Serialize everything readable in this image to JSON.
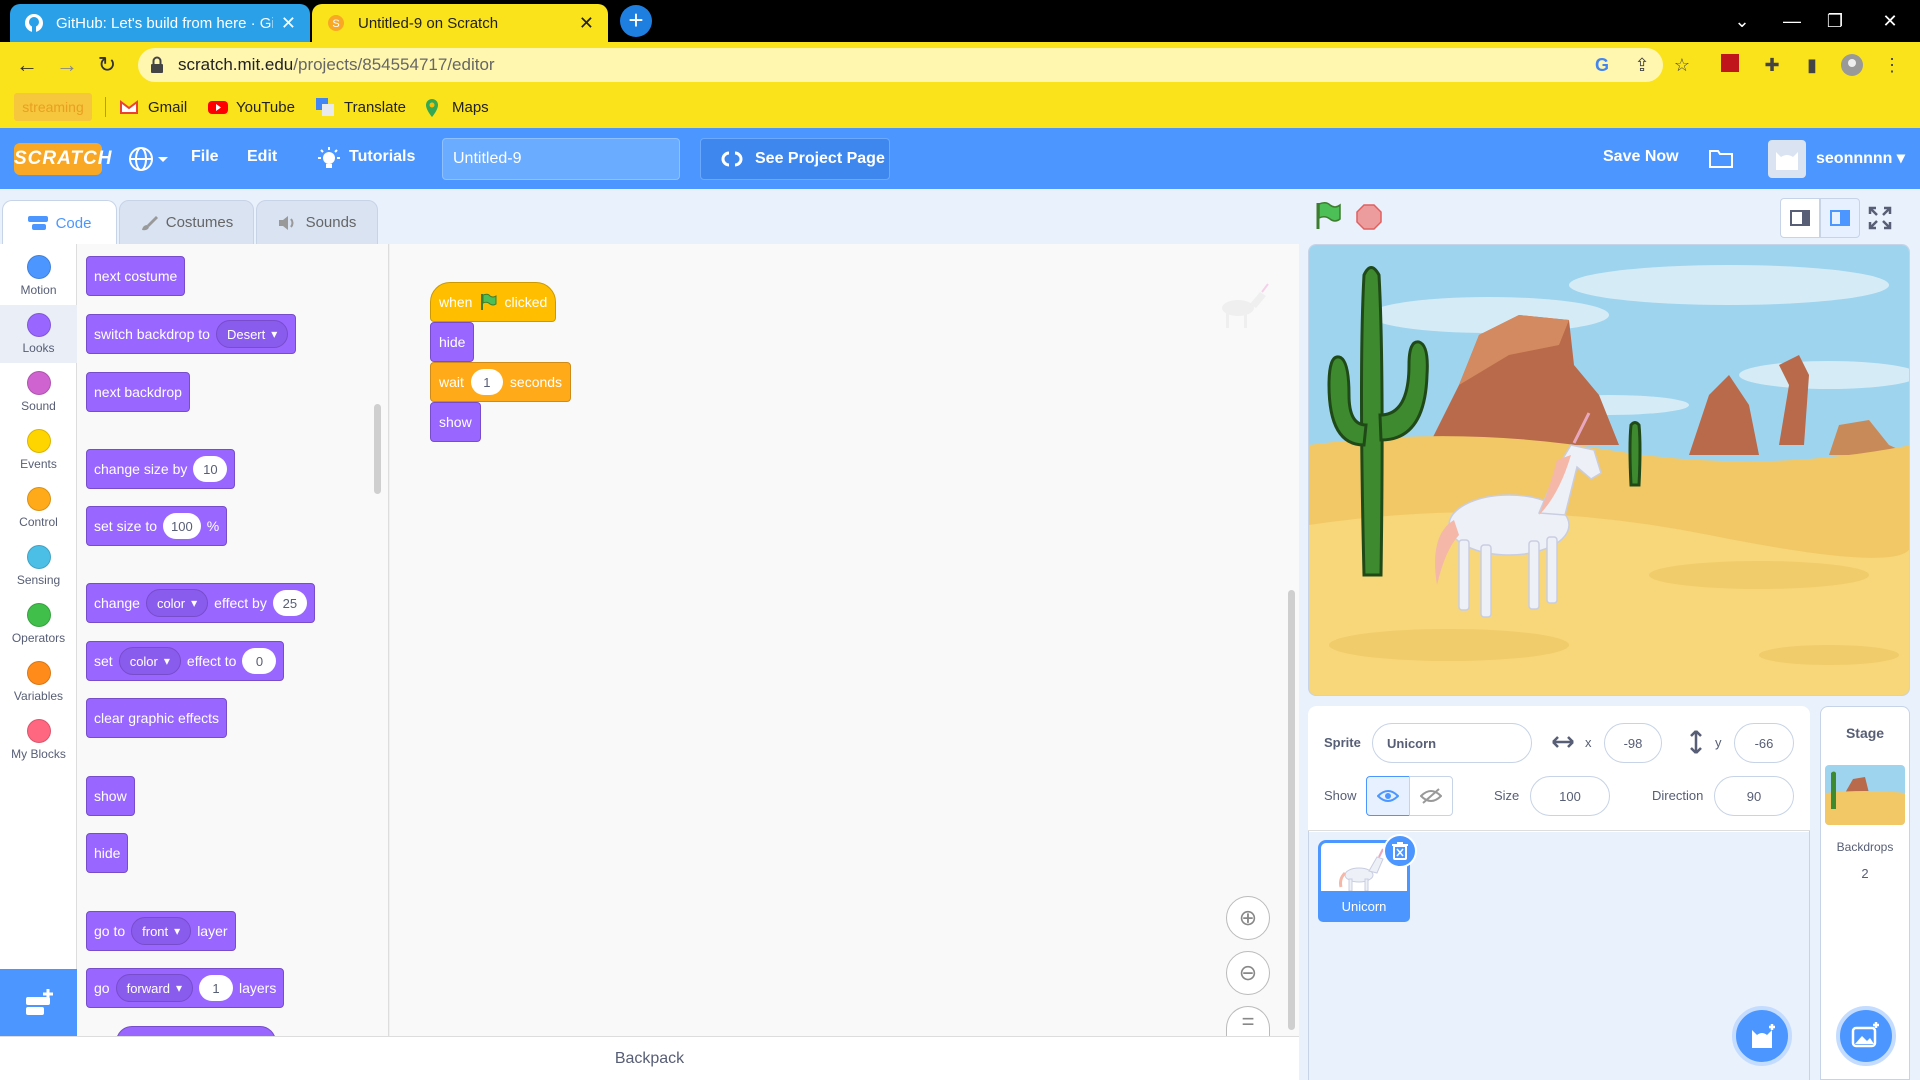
{
  "browser": {
    "tabs": [
      {
        "title": "GitHub: Let's build from here · Gi",
        "active": false
      },
      {
        "title": "Untitled-9 on Scratch",
        "active": true
      }
    ],
    "url_host": "scratch.mit.edu",
    "url_path": "/projects/854554717/editor",
    "bookmarks": [
      "streaming",
      "Gmail",
      "YouTube",
      "Translate",
      "Maps"
    ]
  },
  "menubar": {
    "logo": "SCRATCH",
    "file": "File",
    "edit": "Edit",
    "tutorials": "Tutorials",
    "project_title": "Untitled-9",
    "see_project": "See Project Page",
    "save_now": "Save Now",
    "username": "seonnnnn"
  },
  "editor_tabs": [
    "Code",
    "Costumes",
    "Sounds"
  ],
  "categories": [
    {
      "label": "Motion",
      "color": "#4c97ff"
    },
    {
      "label": "Looks",
      "color": "#9966ff"
    },
    {
      "label": "Sound",
      "color": "#cf63cf"
    },
    {
      "label": "Events",
      "color": "#ffd500"
    },
    {
      "label": "Control",
      "color": "#ffab19"
    },
    {
      "label": "Sensing",
      "color": "#4cbfe6"
    },
    {
      "label": "Operators",
      "color": "#40bf4a"
    },
    {
      "label": "Variables",
      "color": "#ff8c1a"
    },
    {
      "label": "My Blocks",
      "color": "#ff6680"
    }
  ],
  "palette": {
    "next_costume": "next costume",
    "switch_backdrop": "switch backdrop to",
    "backdrop_value": "Desert",
    "next_backdrop": "next backdrop",
    "change_size": "change size by",
    "change_size_val": "10",
    "set_size": "set size to",
    "set_size_val": "100",
    "percent": "%",
    "change": "change",
    "effect_color": "color",
    "effect_by": "effect by",
    "change_effect_val": "25",
    "set": "set",
    "effect_to": "effect to",
    "set_effect_val": "0",
    "clear_effects": "clear graphic effects",
    "show": "show",
    "hide": "hide",
    "go_to": "go to",
    "front": "front",
    "layer": "layer",
    "go": "go",
    "forward": "forward",
    "layers_val": "1",
    "layers": "layers"
  },
  "script": {
    "when": "when",
    "clicked": "clicked",
    "hide": "hide",
    "wait": "wait",
    "wait_val": "1",
    "seconds": "seconds",
    "show": "show"
  },
  "backpack": "Backpack",
  "sprite": {
    "label": "Sprite",
    "name": "Unicorn",
    "x_label": "x",
    "x": "-98",
    "y_label": "y",
    "y": "-66",
    "show_label": "Show",
    "size_label": "Size",
    "size": "100",
    "direction_label": "Direction",
    "direction": "90",
    "thumb_name": "Unicorn"
  },
  "stage_panel": {
    "title": "Stage",
    "backdrops_label": "Backdrops",
    "backdrops_count": "2"
  },
  "colors": {
    "scratch_blue": "#4c97ff",
    "looks": "#9966ff",
    "control": "#ffab19",
    "events": "#ffbf00",
    "browser_theme": "#fbe31c"
  }
}
